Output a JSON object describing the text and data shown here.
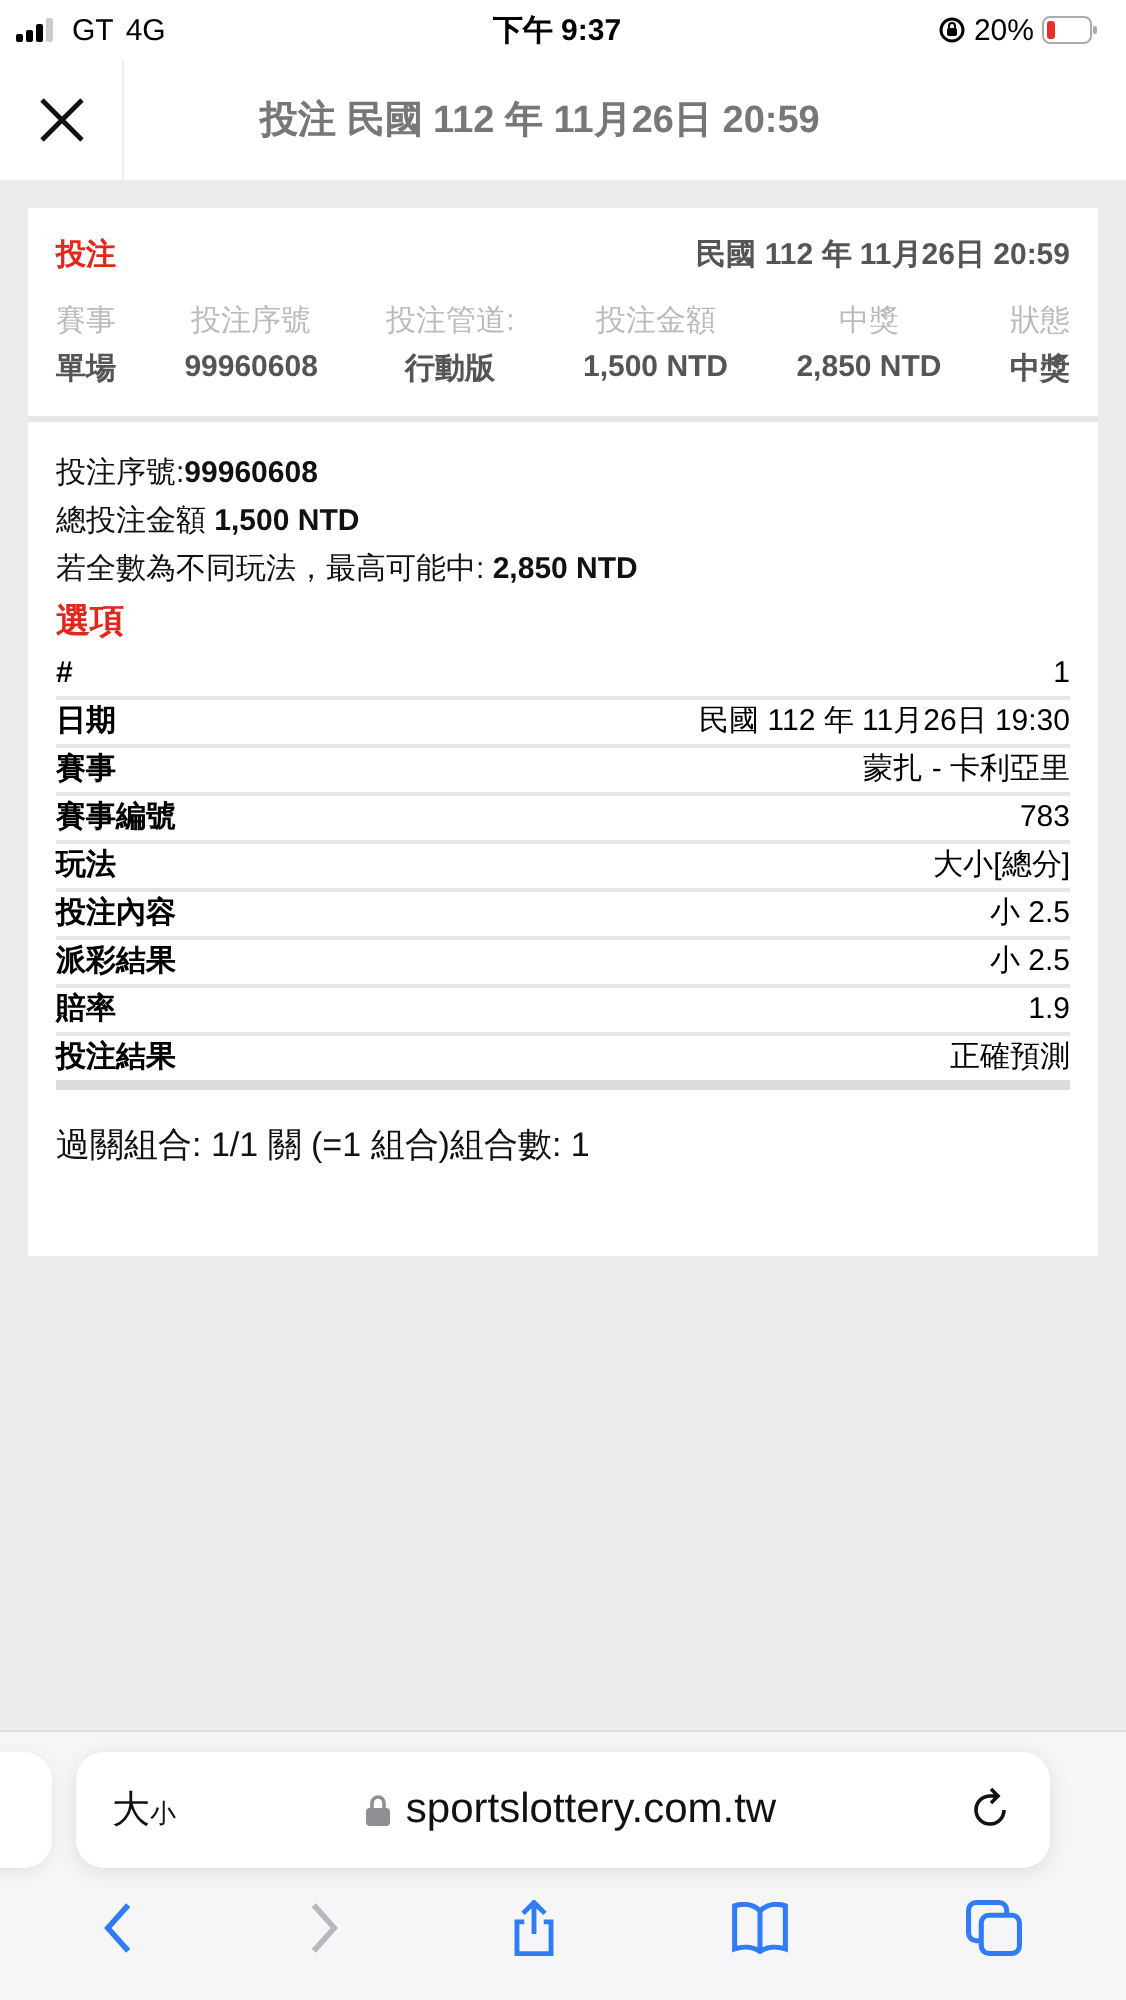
{
  "status_bar": {
    "carrier": "GT",
    "network": "4G",
    "time": "下午 9:37",
    "battery": "20%"
  },
  "header": {
    "title": "投注 民國 112 年 11月26日 20:59"
  },
  "summary": {
    "heading": "投注",
    "date": "民國 112 年 11月26日 20:59",
    "columns": [
      {
        "label": "賽事",
        "value": "單場"
      },
      {
        "label": "投注序號",
        "value": "99960608"
      },
      {
        "label": "投注管道:",
        "value": "行動版"
      },
      {
        "label": "投注金額",
        "value": "1,500 NTD"
      },
      {
        "label": "中獎",
        "value": "2,850 NTD"
      },
      {
        "label": "狀態",
        "value": "中獎"
      }
    ]
  },
  "details": {
    "lines": [
      "投注序號:**99960608**",
      "總投注金額 **1,500 NTD**",
      "若全數為不同玩法，最高可能中: **2,850 NTD**"
    ],
    "options_heading": "選項",
    "rows": [
      {
        "label": "#",
        "value": "1"
      },
      {
        "label": "日期",
        "value": "民國 112 年 11月26日 19:30"
      },
      {
        "label": "賽事",
        "value": "蒙扎 - 卡利亞里"
      },
      {
        "label": "賽事編號",
        "value": "783"
      },
      {
        "label": "玩法",
        "value": "大小[總分]"
      },
      {
        "label": "投注內容",
        "value": "小 2.5"
      },
      {
        "label": "派彩結果",
        "value": "小 2.5"
      },
      {
        "label": "賠率",
        "value": "1.9"
      },
      {
        "label": "投注結果",
        "value": "正確預測"
      }
    ],
    "combination": "過關組合: 1/1 關 (=1 組合)組合數: 1"
  },
  "browser": {
    "text_size_button": "大小",
    "url": "sportslottery.com.tw",
    "toolbar": [
      {
        "kind": "back",
        "disabled": false
      },
      {
        "kind": "forward",
        "disabled": true
      },
      {
        "kind": "share",
        "disabled": false
      },
      {
        "kind": "bookmarks",
        "disabled": false
      },
      {
        "kind": "tabs",
        "disabled": false
      }
    ]
  }
}
